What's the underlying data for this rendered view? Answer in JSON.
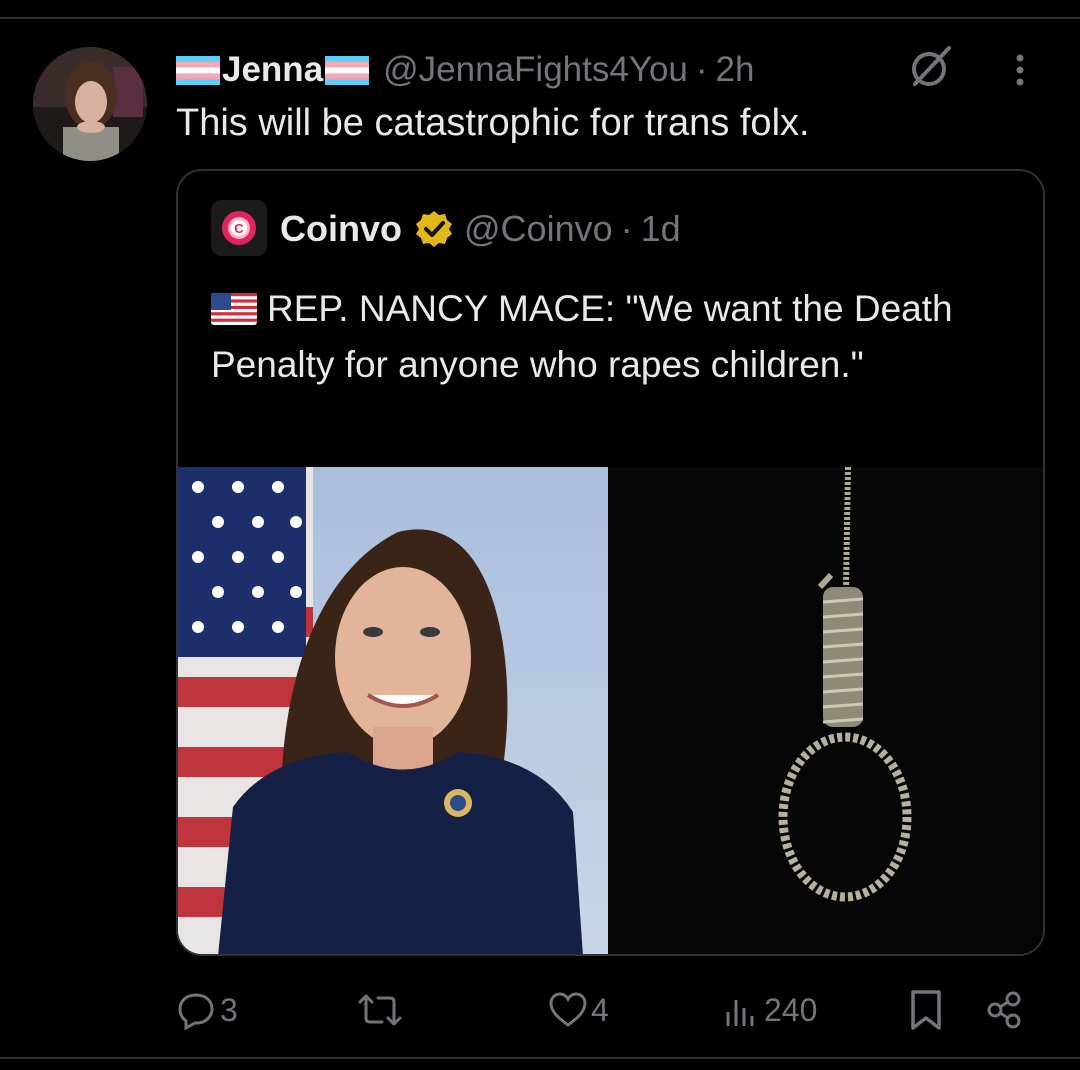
{
  "tweet": {
    "author_name": "Jenna",
    "author_handle": "@JennaFights4You",
    "separator": "·",
    "time": "2h",
    "text": "This will be catastrophic for trans folx."
  },
  "quoted_tweet": {
    "author_name": "Coinvo",
    "author_handle": "@Coinvo",
    "separator": "·",
    "time": "1d",
    "text": "REP. NANCY MACE: \"We want the Death Penalty for anyone who rapes children.\"",
    "flag_icon": "us-flag-emoji",
    "verified_color": "#e2b719",
    "images": [
      {
        "name": "portrait-photo"
      },
      {
        "name": "noose-photo"
      }
    ]
  },
  "actions": {
    "replies": "3",
    "reposts": "",
    "likes": "4",
    "views": "240"
  },
  "colors": {
    "background": "#000000",
    "text": "#e7e9ea",
    "muted": "#71767b",
    "border": "#2f3336"
  }
}
